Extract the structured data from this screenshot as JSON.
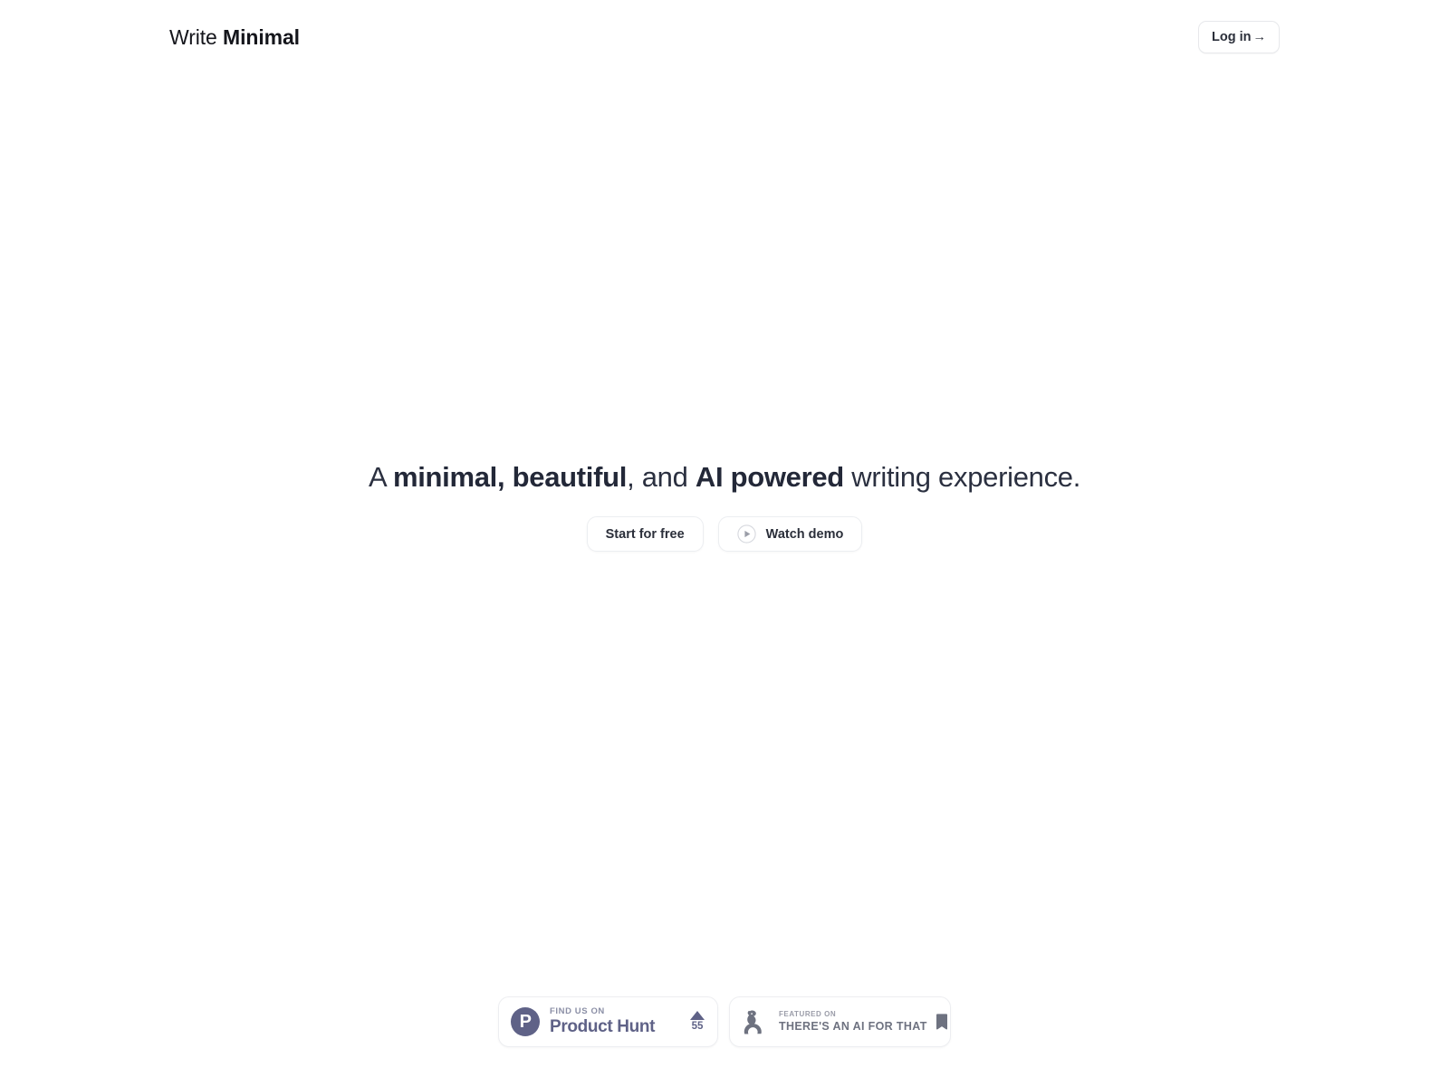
{
  "header": {
    "brand_light": "Write ",
    "brand_strong": "Minimal",
    "login_label": "Log in",
    "login_arrow": "→"
  },
  "hero": {
    "headline_parts": {
      "p1": "A ",
      "p2": "minimal",
      "p3": ", ",
      "p4": "beautiful",
      "p5": ", and ",
      "p6": "AI powered",
      "p7": " writing experience."
    },
    "primary_cta": "Start for free",
    "secondary_cta": "Watch demo"
  },
  "badges": {
    "product_hunt": {
      "kicker": "FIND US ON",
      "name": "Product Hunt",
      "logo_letter": "P",
      "upvotes": "55"
    },
    "theres_an_ai_for_that": {
      "kicker": "FEATURED ON",
      "name": "THERE'S AN AI FOR THAT"
    }
  },
  "colors": {
    "page_background": "#ffffff",
    "heading_text": "#2b3040",
    "border": "#eceef1",
    "product_hunt_purple": "#5f6287",
    "taaft_gray": "#6e7280"
  }
}
